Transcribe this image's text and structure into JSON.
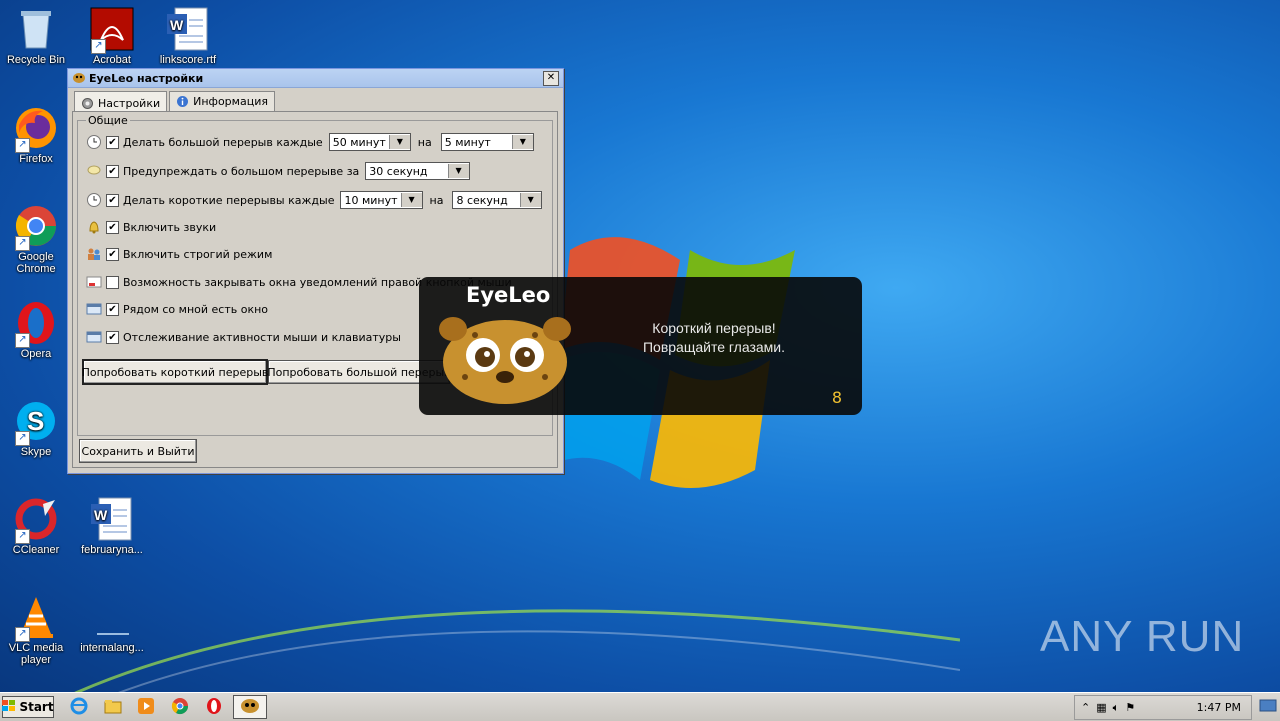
{
  "desktop": {
    "icons": [
      {
        "label": "Recycle Bin"
      },
      {
        "label": "Acrobat"
      },
      {
        "label": "linkscore.rtf"
      },
      {
        "label": "Firefox"
      },
      {
        "label": "Google Chrome"
      },
      {
        "label": "Opera"
      },
      {
        "label": "Skype"
      },
      {
        "label": "CCleaner"
      },
      {
        "label": "februaryna..."
      },
      {
        "label": "VLC media player"
      },
      {
        "label": "internalang..."
      }
    ],
    "watermark": "ANY RUN"
  },
  "settings_window": {
    "title": "EyeLeo настройки",
    "close_glyph": "✕",
    "tabs": [
      {
        "label": "Настройки",
        "active": true
      },
      {
        "label": "Информация",
        "active": false
      }
    ],
    "group_label": "Общие",
    "rows": [
      {
        "label": "Делать большой перерыв каждые",
        "checked": true,
        "select1": "50 минут",
        "mid": "на",
        "select2": "5 минут"
      },
      {
        "label": "Предупреждать о большом перерыве за",
        "checked": true,
        "select1": "30 секунд"
      },
      {
        "label": "Делать короткие перерывы каждые",
        "checked": true,
        "select1": "10 минут",
        "mid": "на",
        "select2": "8 секунд"
      },
      {
        "label": "Включить звуки",
        "checked": true
      },
      {
        "label": "Включить строгий режим",
        "checked": true
      },
      {
        "label": "Возможность закрывать окна уведомлений правой кнопкой мыши",
        "checked": false
      },
      {
        "label": "Рядом со мной есть окно",
        "checked": true
      },
      {
        "label": "Отслеживание активности мыши и клавиатуры",
        "checked": true
      }
    ],
    "buttons": {
      "try_short": "Попробовать короткий перерыв",
      "try_long": "Попробовать большой перерыв",
      "save_exit": "Сохранить и Выйти"
    },
    "check_glyph": "✔"
  },
  "notification": {
    "title": "EyeLeo",
    "line1": "Короткий перерыв!",
    "line2": "Повращайте глазами.",
    "countdown": "8"
  },
  "taskbar": {
    "start_label": "Start",
    "clock": "1:47 PM"
  },
  "colors": {
    "accent_title": "#bcd3f3",
    "notif_bg": "#080808",
    "countdown": "#f0c030"
  }
}
